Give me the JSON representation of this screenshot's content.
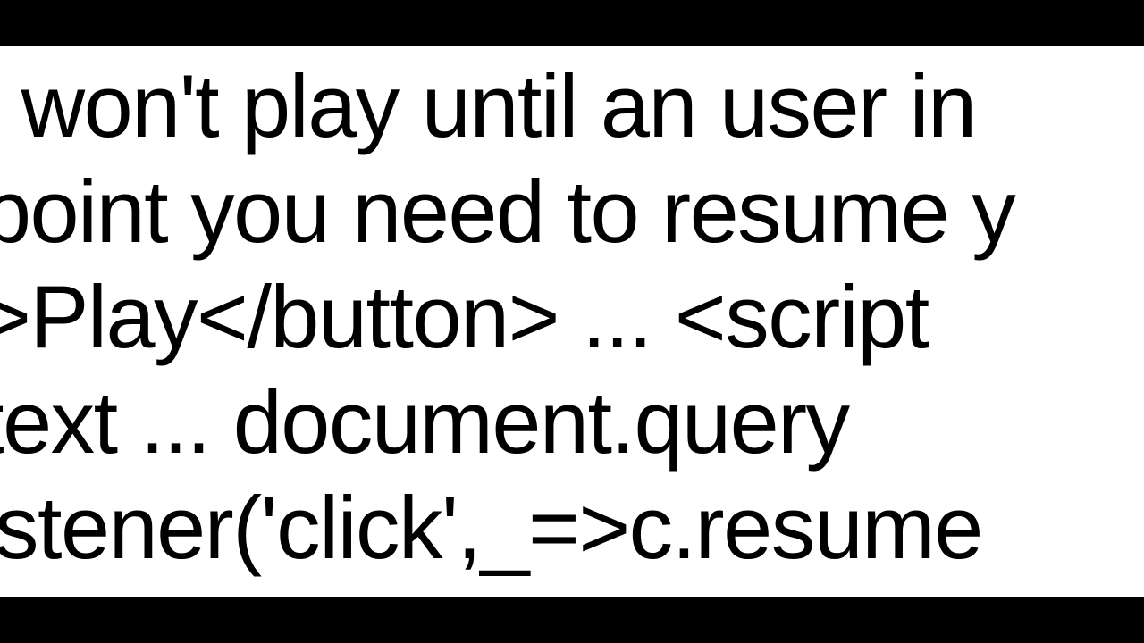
{
  "lines": {
    "l1": "dio won't play until an user in",
    "l2": "point you need to resume y",
    "l3": "on>Play</button> ...   <script",
    "l4": "ontext   ...    document.query",
    "l5": "Listener('click',_=>c.resume"
  }
}
